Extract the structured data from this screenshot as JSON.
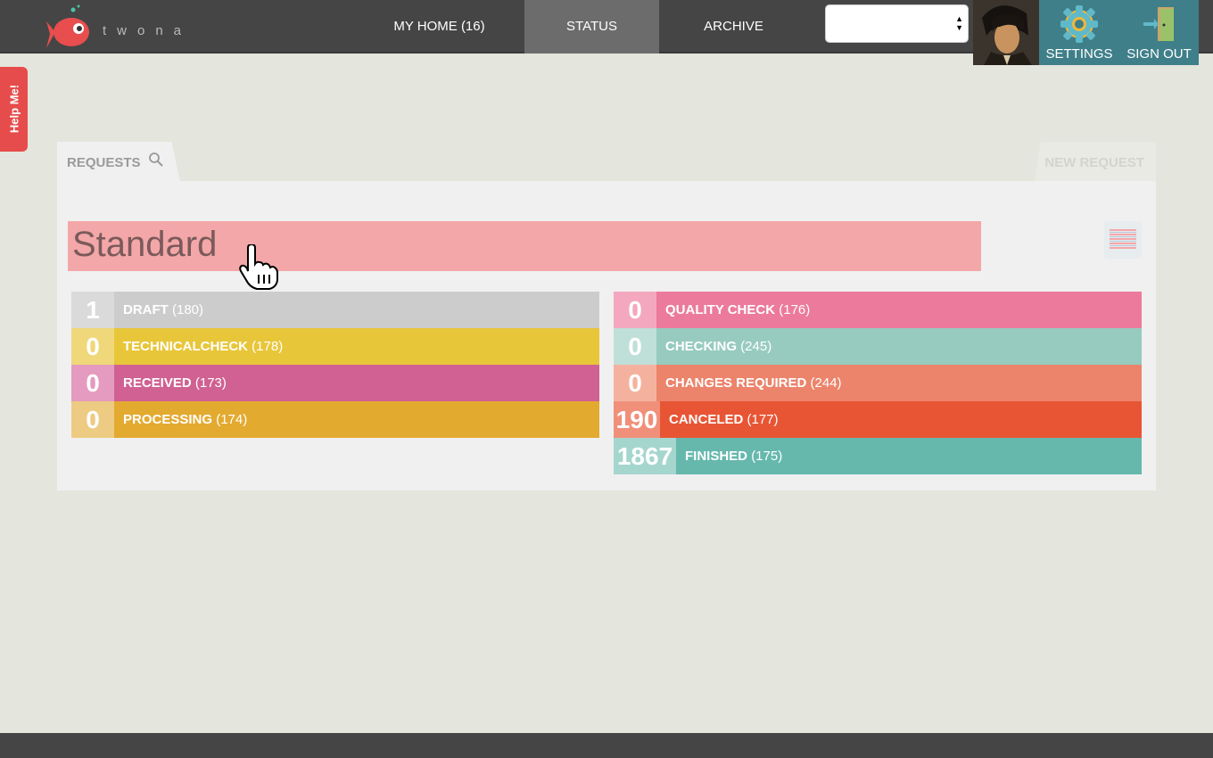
{
  "header": {
    "logo_text": "twona",
    "nav": [
      {
        "label": "MY HOME (16)"
      },
      {
        "label": "STATUS"
      },
      {
        "label": "ARCHIVE"
      }
    ],
    "select_value": "",
    "settings_label": "SETTINGS",
    "signout_label": "SIGN OUT"
  },
  "help": {
    "label": "Help Me!"
  },
  "panel": {
    "tab_requests": "REQUESTS",
    "tab_new": "NEW REQUEST",
    "title": "Standard"
  },
  "left_statuses": [
    {
      "count": "1",
      "label": "DRAFT",
      "total": "(180)",
      "count_color": "#dadada",
      "bar_color": "#cccccc"
    },
    {
      "count": "0",
      "label": "TECHNICALCHECK",
      "total": "(178)",
      "count_color": "#f0d87a",
      "bar_color": "#e8c63a"
    },
    {
      "count": "0",
      "label": "RECEIVED",
      "total": "(173)",
      "count_color": "#e49bbf",
      "bar_color": "#d06192"
    },
    {
      "count": "0",
      "label": "PROCESSING",
      "total": "(174)",
      "count_color": "#eecb82",
      "bar_color": "#e3aa30"
    }
  ],
  "right_statuses": [
    {
      "count": "0",
      "label": "QUALITY CHECK",
      "total": "(176)",
      "count_color": "#f4a8c0",
      "bar_color": "#ec7a9c"
    },
    {
      "count": "0",
      "label": "CHECKING",
      "total": "(245)",
      "count_color": "#bfe0d8",
      "bar_color": "#97cbbf"
    },
    {
      "count": "0",
      "label": "CHANGES REQUIRED",
      "total": "(244)",
      "count_color": "#f4b29e",
      "bar_color": "#ec836b"
    },
    {
      "count": "190",
      "label": "CANCELED",
      "total": "(177)",
      "count_color": "#f0907a",
      "bar_color": "#e85535"
    },
    {
      "count": "1867",
      "label": "FINISHED",
      "total": "(175)",
      "count_color": "#a5d6ce",
      "bar_color": "#66b8ad"
    }
  ]
}
